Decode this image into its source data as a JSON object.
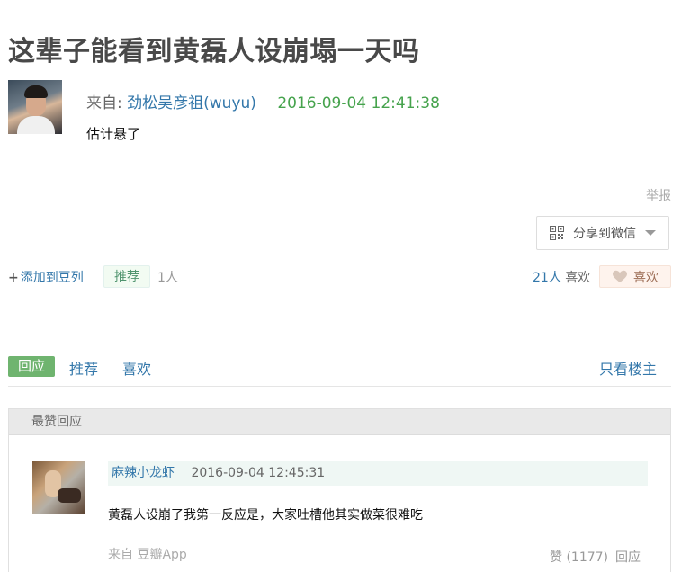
{
  "title": "这辈子能看到黄磊人设崩塌一天吗",
  "post": {
    "from_label": "来自:",
    "author": "劲松吴彦祖(wuyu)",
    "datetime": "2016-09-04 12:41:38",
    "content": "估计悬了",
    "report_label": "举报",
    "share_label": "分享到微信"
  },
  "actions": {
    "add_doulist_plus": "+",
    "add_doulist_label": "添加到豆列",
    "recommend_label": "推荐",
    "recommend_count": "1人",
    "like_count": "21人",
    "like_count_label": "喜欢",
    "like_button_label": "喜欢"
  },
  "tabs": {
    "reply": "回应",
    "recommend": "推荐",
    "like": "喜欢",
    "op_only": "只看楼主"
  },
  "best_replies": {
    "header": "最赞回应",
    "items": [
      {
        "author": "麻辣小龙虾",
        "datetime": "2016-09-04 12:45:31",
        "content": "黄磊人设崩了我第一反应是，大家吐槽他其实做菜很难吃",
        "source": "来自 豆瓣App",
        "vote": "赞 (1177)",
        "reply": "回应"
      }
    ]
  },
  "colors": {
    "link": "#3377aa",
    "date_green": "#46a34d",
    "tab_active_bg": "#6fb46f",
    "like_bg": "#fef3ed"
  }
}
